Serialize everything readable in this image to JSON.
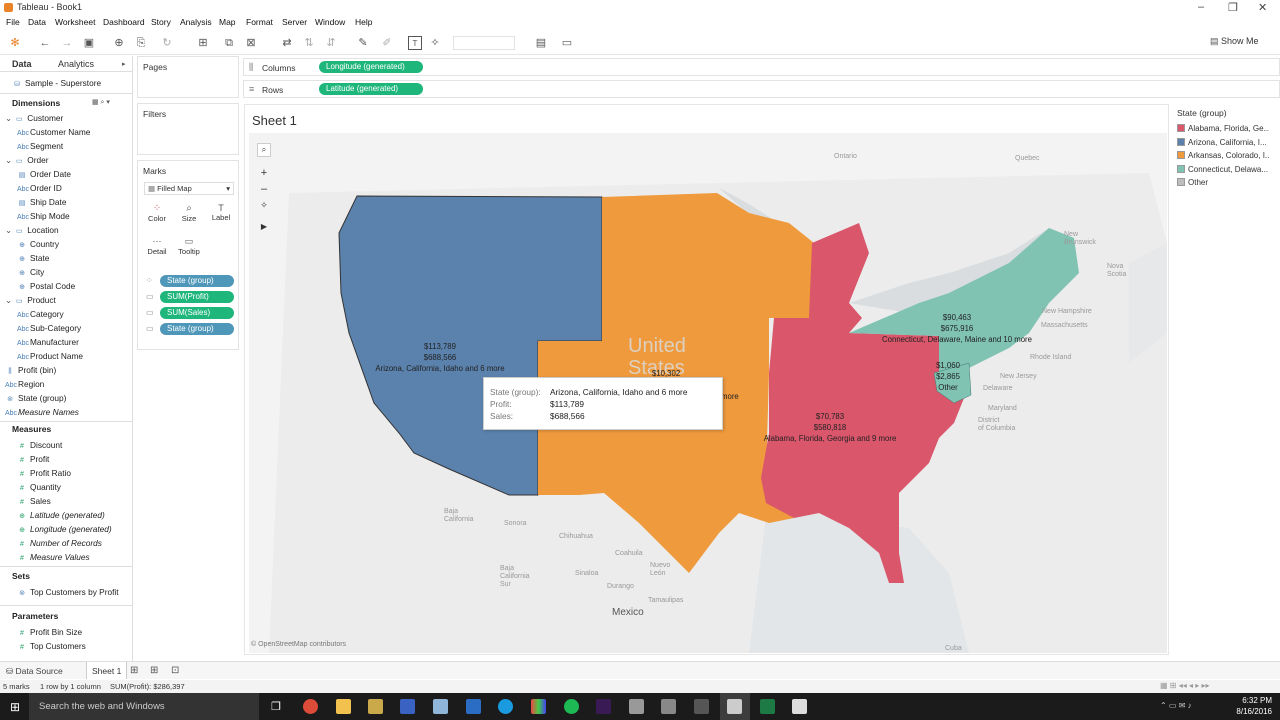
{
  "window": {
    "title": "Tableau - Book1"
  },
  "menu": [
    "File",
    "Data",
    "Worksheet",
    "Dashboard",
    "Story",
    "Analysis",
    "Map",
    "Format",
    "Server",
    "Window",
    "Help"
  ],
  "toolbar": {
    "show_me": "Show Me"
  },
  "left_tabs": {
    "data": "Data",
    "analytics": "Analytics"
  },
  "datasource": "Sample - Superstore",
  "dimensions_header": "Dimensions",
  "dimensions": [
    {
      "label": "Customer",
      "level": 0,
      "type": "folder"
    },
    {
      "label": "Customer Name",
      "level": 1,
      "type": "abc"
    },
    {
      "label": "Segment",
      "level": 1,
      "type": "abc"
    },
    {
      "label": "Order",
      "level": 0,
      "type": "folder"
    },
    {
      "label": "Order Date",
      "level": 1,
      "type": "date"
    },
    {
      "label": "Order ID",
      "level": 1,
      "type": "abc"
    },
    {
      "label": "Ship Date",
      "level": 1,
      "type": "date"
    },
    {
      "label": "Ship Mode",
      "level": 1,
      "type": "abc"
    },
    {
      "label": "Location",
      "level": 0,
      "type": "folder"
    },
    {
      "label": "Country",
      "level": 1,
      "type": "geo"
    },
    {
      "label": "State",
      "level": 1,
      "type": "geo"
    },
    {
      "label": "City",
      "level": 1,
      "type": "geo"
    },
    {
      "label": "Postal Code",
      "level": 1,
      "type": "geo"
    },
    {
      "label": "Product",
      "level": 0,
      "type": "folder"
    },
    {
      "label": "Category",
      "level": 1,
      "type": "abc"
    },
    {
      "label": "Sub-Category",
      "level": 1,
      "type": "abc"
    },
    {
      "label": "Manufacturer",
      "level": 1,
      "type": "abc"
    },
    {
      "label": "Product Name",
      "level": 1,
      "type": "abc"
    },
    {
      "label": "Profit (bin)",
      "level": 0,
      "type": "bin"
    },
    {
      "label": "Region",
      "level": 0,
      "type": "abc"
    },
    {
      "label": "State (group)",
      "level": 0,
      "type": "group"
    },
    {
      "label": "Measure Names",
      "level": 0,
      "type": "abc",
      "italic": true
    }
  ],
  "measures_header": "Measures",
  "measures": [
    {
      "label": "Discount",
      "italic": false
    },
    {
      "label": "Profit",
      "italic": false
    },
    {
      "label": "Profit Ratio",
      "italic": false
    },
    {
      "label": "Quantity",
      "italic": false
    },
    {
      "label": "Sales",
      "italic": false
    },
    {
      "label": "Latitude (generated)",
      "italic": true
    },
    {
      "label": "Longitude (generated)",
      "italic": true
    },
    {
      "label": "Number of Records",
      "italic": true
    },
    {
      "label": "Measure Values",
      "italic": true
    }
  ],
  "sets_header": "Sets",
  "sets": [
    "Top Customers by Profit"
  ],
  "params_header": "Parameters",
  "params": [
    "Profit Bin Size",
    "Top Customers"
  ],
  "pages_label": "Pages",
  "filters_label": "Filters",
  "marks": {
    "label": "Marks",
    "type": "Filled Map",
    "buttons": [
      "Color",
      "Size",
      "Label",
      "Detail",
      "Tooltip"
    ],
    "pills": [
      {
        "label": "State (group)",
        "color": "#4e97b8"
      },
      {
        "label": "SUM(Profit)",
        "color": "#1fb67b"
      },
      {
        "label": "SUM(Sales)",
        "color": "#1fb67b"
      },
      {
        "label": "State (group)",
        "color": "#4e97b8"
      }
    ]
  },
  "shelves": {
    "columns_label": "Columns",
    "columns_pill": "Longitude (generated)",
    "rows_label": "Rows",
    "rows_pill": "Latitude (generated)"
  },
  "sheet_title": "Sheet 1",
  "legend": {
    "title": "State (group)",
    "items": [
      {
        "label": "Alabama, Florida, Ge...",
        "color": "#d9566b"
      },
      {
        "label": "Arizona, California, I...",
        "color": "#5b82ad"
      },
      {
        "label": "Arkansas, Colorado, I...",
        "color": "#ef9a3d"
      },
      {
        "label": "Connecticut, Delawa...",
        "color": "#80c3b3"
      },
      {
        "label": "Other",
        "color": "#bdbdbd"
      }
    ]
  },
  "map": {
    "attribution": "© OpenStreetMap contributors",
    "place_labels": {
      "ontario": "Ontario",
      "quebec": "Quebec",
      "new_brunswick": "New\nBrunswick",
      "nova_scotia": "Nova\nScotia",
      "new_hampshire": "New Hampshire",
      "massachusetts": "Massachusetts",
      "rhode_island": "Rhode Island",
      "new_jersey": "New Jersey",
      "delaware": "Delaware",
      "maryland": "Maryland",
      "dc": "District\nof Columbia",
      "united_states": "United\nStates",
      "baja_california": "Baja\nCalifornia",
      "sonora": "Sonora",
      "chihuahua": "Chihuahua",
      "coahuila": "Coahuila",
      "nuevo_leon": "Nuevo\nLeón",
      "baja_california_sur": "Baja\nCalifornia\nSur",
      "sinaloa": "Sinaloa",
      "durango": "Durango",
      "tamaulipas": "Tamaulipas",
      "mexico": "Mexico",
      "cuba": "Cuba"
    },
    "regions": [
      {
        "name": "West",
        "profit": "$113,789",
        "sales": "$688,566",
        "label": "Arizona, California, Idaho and 6 more",
        "color": "#5b82ad"
      },
      {
        "name": "Central",
        "profit": "$10,302",
        "sales": "",
        "label": "more",
        "color": "#ef9a3d"
      },
      {
        "name": "South",
        "profit": "$70,783",
        "sales": "$580,818",
        "label": "Alabama, Florida, Georgia and 9 more",
        "color": "#d9566b"
      },
      {
        "name": "Northeast",
        "profit": "$90,463",
        "sales": "$675,916",
        "label": "Connecticut, Delaware, Maine and 10 more",
        "color": "#80c3b3"
      },
      {
        "name": "Other",
        "profit": "$1,060",
        "sales": "$2,865",
        "label": "Other",
        "color": "#bdbdbd"
      }
    ]
  },
  "tooltip": {
    "rows": [
      {
        "k": "State (group):",
        "v": "Arizona, California, Idaho and 6 more"
      },
      {
        "k": "Profit:",
        "v": "$113,789"
      },
      {
        "k": "Sales:",
        "v": "$688,566"
      }
    ]
  },
  "bottom_tabs": {
    "datasource": "Data Source",
    "sheet": "Sheet 1"
  },
  "status": {
    "marks": "5 marks",
    "dims": "1 row by 1 column",
    "sum": "SUM(Profit): $286,397"
  },
  "taskbar": {
    "search": "Search the web and Windows",
    "time": "6:32 PM",
    "date": "8/16/2016"
  }
}
